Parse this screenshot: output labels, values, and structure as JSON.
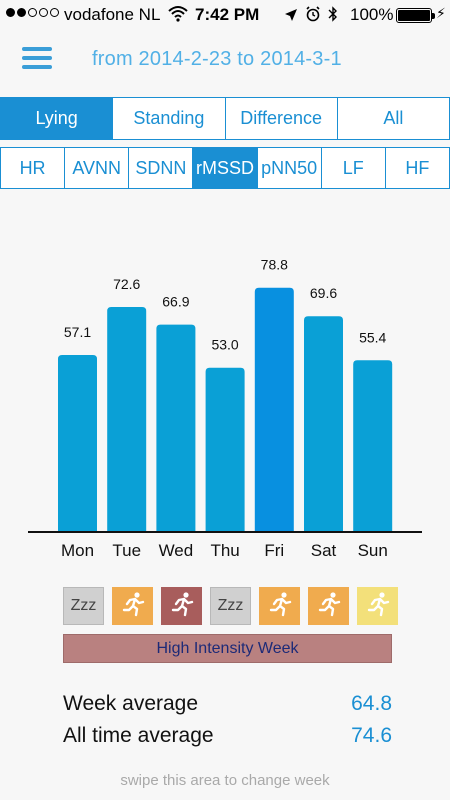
{
  "status_bar": {
    "carrier": "vodafone NL",
    "time": "7:42 PM",
    "battery": "100%"
  },
  "header": {
    "title": "from 2014-2-23 to 2014-3-1"
  },
  "position_tabs": [
    {
      "label": "Lying",
      "active": true
    },
    {
      "label": "Standing",
      "active": false
    },
    {
      "label": "Difference",
      "active": false
    },
    {
      "label": "All",
      "active": false
    }
  ],
  "metric_tabs": [
    {
      "label": "HR",
      "active": false
    },
    {
      "label": "AVNN",
      "active": false
    },
    {
      "label": "SDNN",
      "active": false
    },
    {
      "label": "rMSSD",
      "active": true
    },
    {
      "label": "pNN50",
      "active": false
    },
    {
      "label": "LF",
      "active": false
    },
    {
      "label": "HF",
      "active": false
    }
  ],
  "chart_data": {
    "type": "bar",
    "categories": [
      "Mon",
      "Tue",
      "Wed",
      "Thu",
      "Fri",
      "Sat",
      "Sun"
    ],
    "values": [
      57.1,
      72.6,
      66.9,
      53.0,
      78.8,
      69.6,
      55.4
    ],
    "value_labels": [
      "57.1",
      "72.6",
      "66.9",
      "53.0",
      "78.8",
      "69.6",
      "55.4"
    ],
    "title": "",
    "xlabel": "",
    "ylabel": "",
    "ylim": [
      0,
      100
    ],
    "grid": false,
    "colors": {
      "default": "#0aa0d6",
      "highlight": "#0890e0",
      "highlight_index": 4,
      "baseline": "#111111"
    }
  },
  "activity": [
    {
      "type": "rest",
      "text": "Zzz",
      "color": "#d0d0d0"
    },
    {
      "type": "run",
      "icon": "runner-icon",
      "color": "#f0ab4e"
    },
    {
      "type": "run",
      "icon": "runner-icon",
      "color": "#a85d5c"
    },
    {
      "type": "rest",
      "text": "Zzz",
      "color": "#d0d0d0"
    },
    {
      "type": "run",
      "icon": "runner-icon",
      "color": "#f0ab4e"
    },
    {
      "type": "run",
      "icon": "runner-icon",
      "color": "#f0ab4e"
    },
    {
      "type": "run",
      "icon": "runner-icon",
      "color": "#f3e07a"
    }
  ],
  "week_label": "High Intensity Week",
  "stats": {
    "week_average_label": "Week average",
    "week_average_value": "64.8",
    "all_time_label": "All time average",
    "all_time_value": "74.6"
  },
  "footer_hint": "swipe this area to change week"
}
